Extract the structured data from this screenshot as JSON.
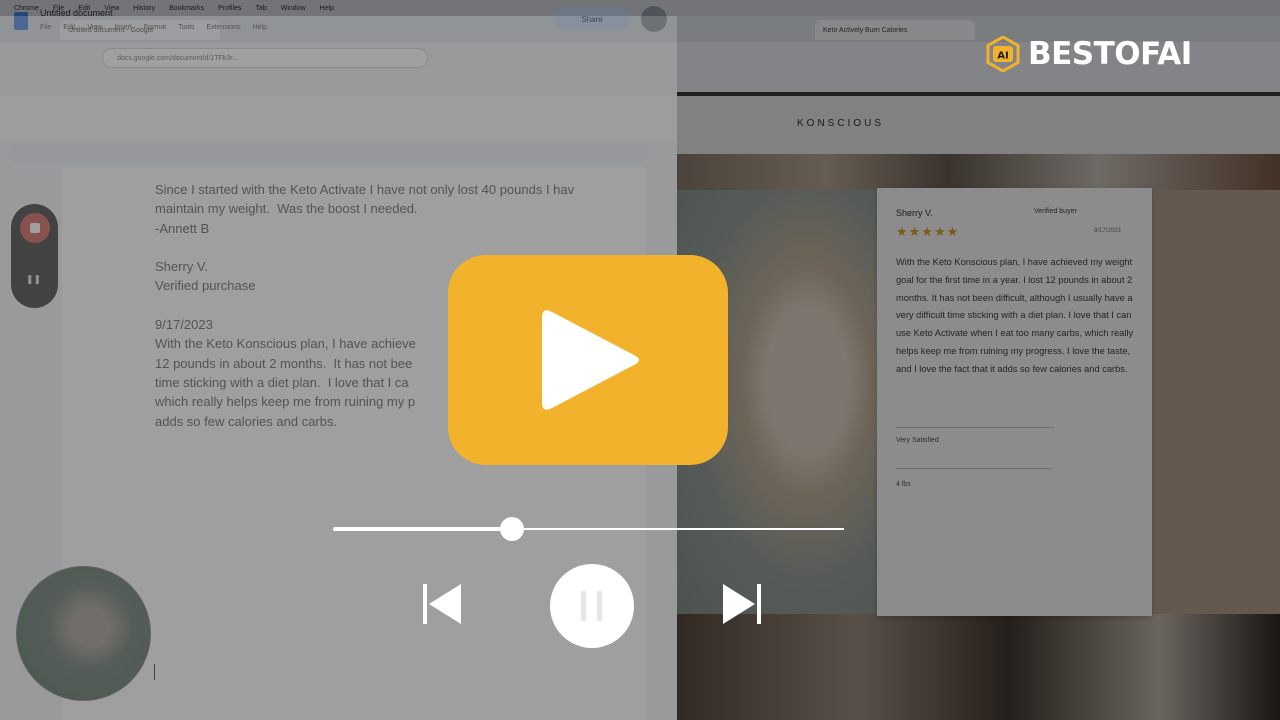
{
  "brand": {
    "name": "BESTOFAI",
    "badge_text": "AI",
    "accent_color": "#f3b22b"
  },
  "player": {
    "progress": 0.35,
    "play_button_color": "#f3b22b",
    "controls": [
      "previous-icon",
      "pause-icon",
      "next-icon"
    ]
  },
  "background": {
    "menubar": {
      "items": [
        "Chrome",
        "File",
        "Edit",
        "View",
        "History",
        "Bookmarks",
        "Profiles",
        "Tab",
        "Window",
        "Help"
      ]
    },
    "tabs": [
      "Untitled document - Google",
      "Keto Actively Burn Calories"
    ],
    "address": "docs.google.com/document/d/1TFk3r...",
    "google_doc": {
      "title": "Untitled document",
      "menu": [
        "File",
        "Edit",
        "View",
        "Insert",
        "Format",
        "Tools",
        "Extensions",
        "Help"
      ],
      "share_label": "Share",
      "text": "Since I started with the Keto Activate I have not only lost 40 pounds I hav\nmaintain my weight.  Was the boost I needed.\n-Annett B\n\nSherry V.\nVerified purchase\n\n9/17/2023\nWith the Keto Konscious plan, I have achieve\n12 pounds in about 2 months.  It has not bee\ntime sticking with a diet plan.  I love that I ca\nwhich really helps keep me from ruining my p\nadds so few calories and carbs."
    },
    "website": {
      "logo": "KONSCIOUS",
      "review": {
        "name": "Sherry V.",
        "badge": "Verified buyer",
        "stars": "★★★★★",
        "date": "9/17/2023",
        "body": "With the Keto Konscious plan, I have achieved my weight goal for the first time in a year. I lost 12 pounds in about 2 months. It has not been difficult, although I usually have a very difficult time sticking with a diet plan. I love that I can use Keto Activate when I eat too many carbs, which really helps keep me from ruining my progress. I love the taste, and I love the fact that it adds so few calories and carbs.",
        "fit_label": "Very Satisfied",
        "lost_label": "4 lbs"
      }
    }
  }
}
